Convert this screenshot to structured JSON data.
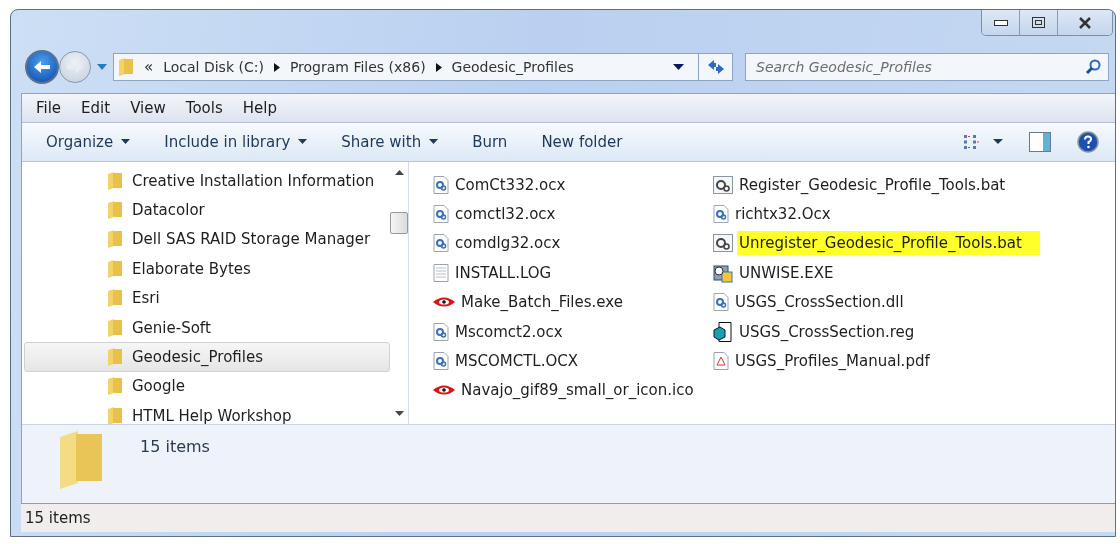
{
  "address": {
    "overflow": "«",
    "crumbs": [
      "Local Disk (C:)",
      "Program Files (x86)",
      "Geodesic_Profiles"
    ]
  },
  "search": {
    "placeholder": "Search Geodesic_Profiles"
  },
  "menu": [
    "File",
    "Edit",
    "View",
    "Tools",
    "Help"
  ],
  "toolbar": [
    {
      "label": "Organize",
      "dropdown": true
    },
    {
      "label": "Include in library",
      "dropdown": true
    },
    {
      "label": "Share with",
      "dropdown": true
    },
    {
      "label": "Burn",
      "dropdown": false
    },
    {
      "label": "New folder",
      "dropdown": false
    }
  ],
  "sidebar": {
    "items": [
      {
        "label": "Creative Installation Information",
        "selected": false
      },
      {
        "label": "Datacolor",
        "selected": false
      },
      {
        "label": "Dell SAS RAID Storage Manager",
        "selected": false
      },
      {
        "label": "Elaborate Bytes",
        "selected": false
      },
      {
        "label": "Esri",
        "selected": false
      },
      {
        "label": "Genie-Soft",
        "selected": false
      },
      {
        "label": "Geodesic_Profiles",
        "selected": true
      },
      {
        "label": "Google",
        "selected": false
      },
      {
        "label": "HTML Help Workshop",
        "selected": false
      }
    ]
  },
  "files": [
    {
      "name": "ComCt332.ocx",
      "kind": "gear",
      "highlighted": false
    },
    {
      "name": "comctl32.ocx",
      "kind": "gear",
      "highlighted": false
    },
    {
      "name": "comdlg32.ocx",
      "kind": "gear",
      "highlighted": false
    },
    {
      "name": "INSTALL.LOG",
      "kind": "text",
      "highlighted": false
    },
    {
      "name": "Make_Batch_Files.exe",
      "kind": "eye",
      "highlighted": false
    },
    {
      "name": "Mscomct2.ocx",
      "kind": "gear",
      "highlighted": false
    },
    {
      "name": "MSCOMCTL.OCX",
      "kind": "gear",
      "highlighted": false
    },
    {
      "name": "Navajo_gif89_small_or_icon.ico",
      "kind": "eye",
      "highlighted": false
    },
    {
      "name": "Register_Geodesic_Profile_Tools.bat",
      "kind": "batch",
      "highlighted": false
    },
    {
      "name": "richtx32.Ocx",
      "kind": "gear",
      "highlighted": false
    },
    {
      "name": "Unregister_Geodesic_Profile_Tools.bat",
      "kind": "batch",
      "highlighted": true
    },
    {
      "name": "UNWISE.EXE",
      "kind": "installer",
      "highlighted": false
    },
    {
      "name": "USGS_CrossSection.dll",
      "kind": "gear",
      "highlighted": false
    },
    {
      "name": "USGS_CrossSection.reg",
      "kind": "registry",
      "highlighted": false
    },
    {
      "name": "USGS_Profiles_Manual.pdf",
      "kind": "pdf",
      "highlighted": false
    }
  ],
  "details": {
    "count": "15 items"
  },
  "status_bar": "15 items"
}
